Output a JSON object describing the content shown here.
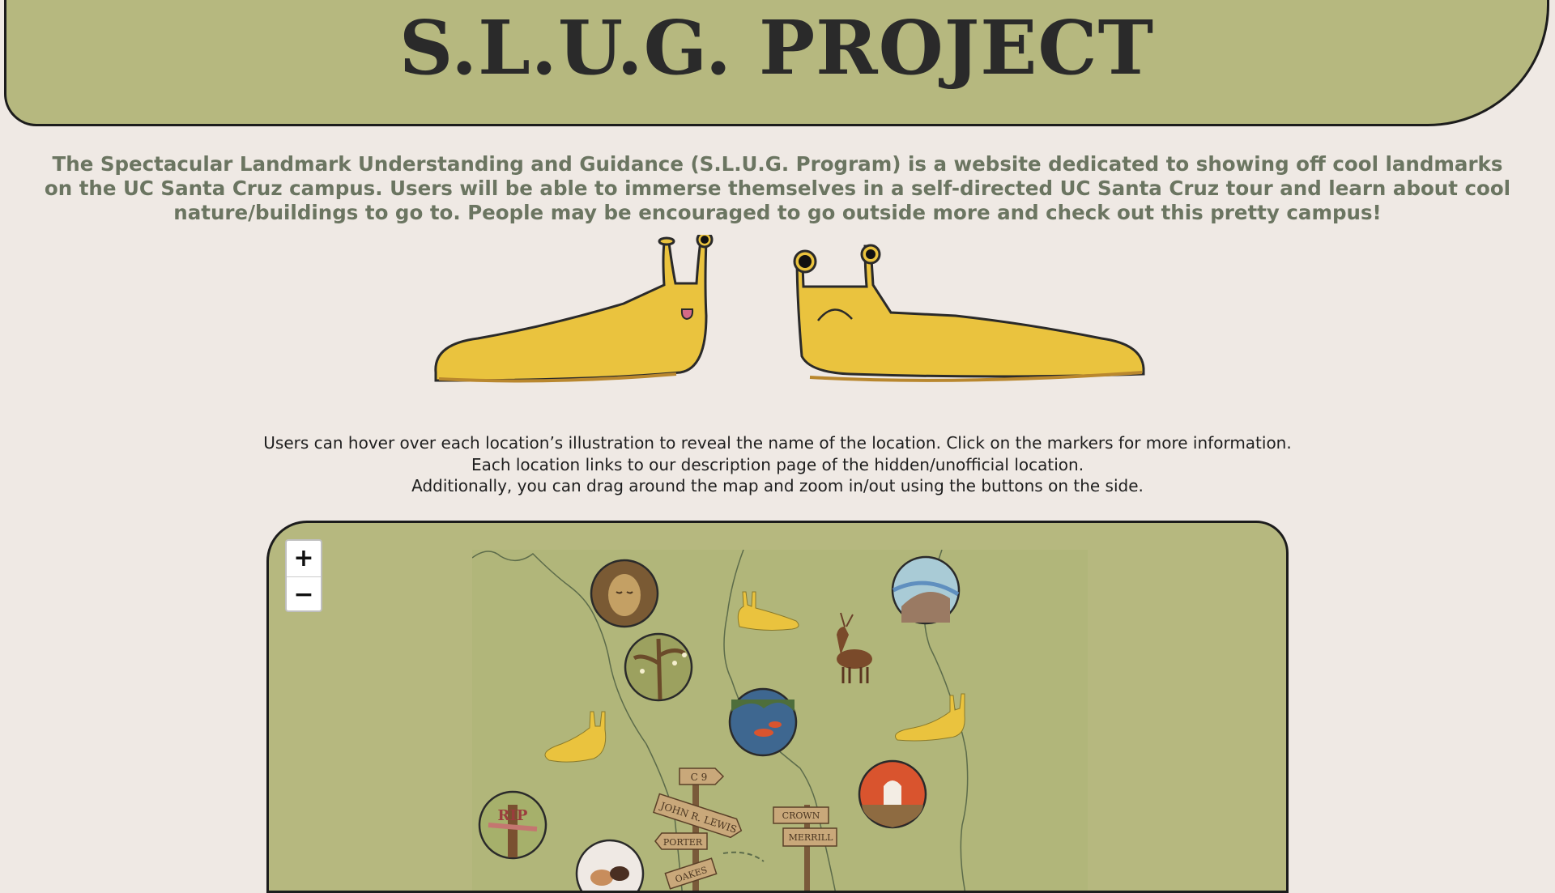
{
  "header": {
    "title": "S.L.U.G. PROJECT"
  },
  "intro": "The Spectacular Landmark Understanding and Guidance (S.L.U.G. Program) is a website dedicated to showing off cool landmarks on the UC Santa Cruz campus. Users will be able to immerse themselves in a self-directed UC Santa Cruz tour and learn about cool nature/buildings to go to. People may be encouraged to go outside more and check out this pretty campus!",
  "instructions": [
    "Users can hover over each location’s illustration to reveal the name of the location. Click on the markers for more information.",
    "Each location links to our description page of the hidden/unofficial location.",
    "Additionally, you can drag around the map and zoom in/out using the buttons on the side."
  ],
  "map": {
    "zoom_in": "+",
    "zoom_out": "−",
    "tombstone_text": "RIP",
    "signs": [
      "C 9",
      "JOHN R. LEWIS",
      "PORTER",
      "CROWN",
      "MERRILL",
      "OAKES"
    ]
  },
  "colors": {
    "banner": "#b6b87f",
    "background": "#efe9e4",
    "slug": "#eac33e",
    "intro_text": "#6b7561"
  }
}
